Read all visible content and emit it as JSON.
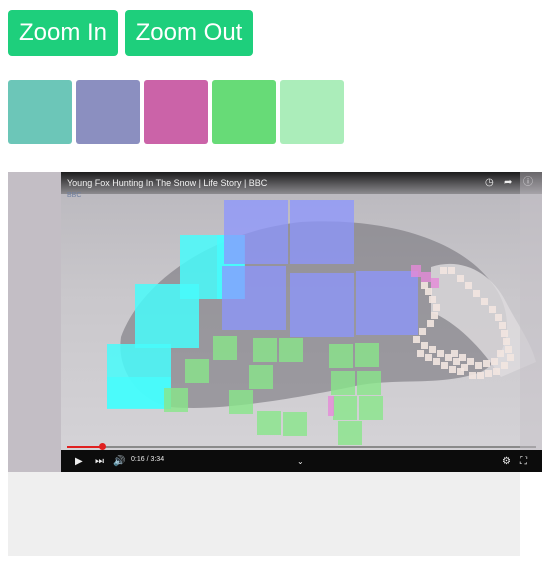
{
  "toolbar": {
    "zoom_in_label": "Zoom In",
    "zoom_out_label": "Zoom Out"
  },
  "palette": [
    {
      "name": "teal",
      "color": "#6cc6b8"
    },
    {
      "name": "periwinkle",
      "color": "#8b8fc0"
    },
    {
      "name": "magenta",
      "color": "#cb63a8"
    },
    {
      "name": "green",
      "color": "#67db77"
    },
    {
      "name": "light-green",
      "color": "#abedba"
    }
  ],
  "video": {
    "title": "Young Fox Hunting In The Snow | Life Story | BBC",
    "channel": "BBC",
    "time_display": "0:16 / 3:34",
    "progress": 0.075,
    "icons": [
      "clock-icon",
      "share-icon",
      "info-icon",
      "play-icon",
      "next-icon",
      "volume-icon",
      "settings-icon",
      "fullscreen-icon"
    ]
  },
  "colors": {
    "button": "#1ecf7c",
    "tile_cyan": "#48fbfb",
    "tile_blue": "#8c96ff",
    "tile_green": "#88e68a",
    "tile_pink": "#e58ad8",
    "tile_cream": "#f2e6e0"
  }
}
